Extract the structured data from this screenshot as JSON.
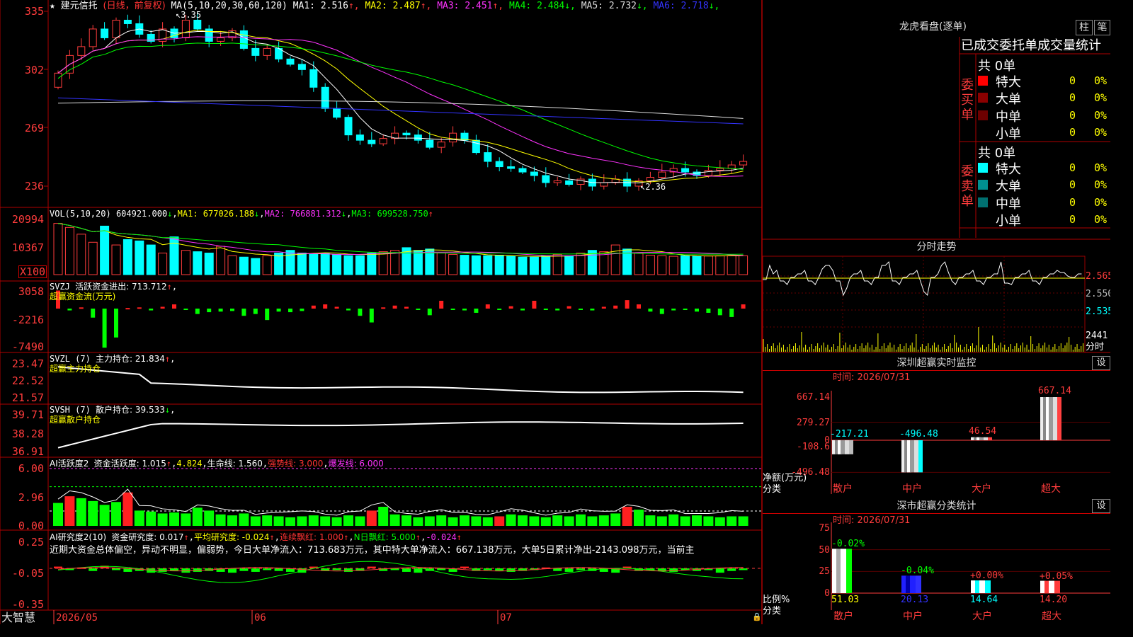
{
  "app": {
    "brand": "大智慧"
  },
  "main": {
    "star": "★",
    "stock": "建元信托",
    "mode": "(日线，前复权)",
    "ma_header": "MA(5,10,20,30,60,120)",
    "ma_items": [
      {
        "label": "MA1: 2.516",
        "arrow": "↑",
        "color": "#ffffff"
      },
      {
        "label": "MA2: 2.487",
        "arrow": "↑",
        "color": "#ffff00"
      },
      {
        "label": "MA3: 2.451",
        "arrow": "↑",
        "color": "#ff33ff"
      },
      {
        "label": "MA4: 2.484",
        "arrow": "↓",
        "color": "#00ff00"
      },
      {
        "label": "MA5: 2.732",
        "arrow": "↓",
        "color": "#dddddd"
      },
      {
        "label": "MA6: 2.718",
        "arrow": "↓",
        "color": "#3333ff"
      }
    ],
    "high_mark": "3.35",
    "low_mark": "2.36",
    "price_axis": [
      "335",
      "302",
      "269",
      "236"
    ]
  },
  "vol": {
    "header": "VOL(5,10,20)",
    "value": "604921.000",
    "ma1": "MA1: 677026.188",
    "ma2": "MA2: 766881.312",
    "ma3": "MA3: 699528.750",
    "axis": [
      "20994",
      "10367"
    ],
    "unit": "X100"
  },
  "svzj": {
    "header": "SVZJ",
    "label": "活跃资金进出: 713.712",
    "subtitle": "超赢资金流(万元)",
    "axis": [
      "3058",
      "-2216",
      "-7490"
    ]
  },
  "svzl": {
    "header": "SVZL (7)",
    "label": "主力持仓: 21.834",
    "subtitle": "超赢主力持仓",
    "axis": [
      "23.47",
      "22.52",
      "21.57"
    ]
  },
  "svsh": {
    "header": "SVSH (7)",
    "label": "散户持仓: 39.533",
    "subtitle": "超赢散户持仓",
    "axis": [
      "39.71",
      "38.28",
      "36.91"
    ]
  },
  "ai1": {
    "header": "AI活跃度2",
    "label1": "资金活跃度: 1.015",
    "v2": "4.824",
    "label3": "生命线: 1.560",
    "label4": "强势线: 3.000",
    "label5": "爆发线: 6.000",
    "axis": [
      "6.00",
      "2.96",
      "0.00"
    ]
  },
  "ai2": {
    "header": "AI研究度2(10)",
    "label1": "资金研究度: 0.017",
    "label2": "平均研究度: -0.024",
    "label3": "连续飘红: 1.000",
    "label4": "N日飘红: 5.000",
    "label5": "-0.024",
    "axis": [
      "0.25",
      "-0.05",
      "-0.35"
    ],
    "note": "近期大资金总体偏空，异动不明显，偏弱势，今日大单净流入：713.683万元，其中特大单净流入：667.138万元，大单5日累计净出-2143.098万元，当前主"
  },
  "date_axis": [
    "2026/05",
    "06",
    "07"
  ],
  "lhb": {
    "title": "龙虎看盘(逐单)",
    "btn1": "柱",
    "btn2": "笔",
    "tabs": "已成交委托单成交量统计",
    "buy_label": "委买单",
    "sell_label": "委卖单",
    "total": "共 0单",
    "rows": [
      {
        "name": "特大",
        "count": "0",
        "pct": "0%"
      },
      {
        "name": "大单",
        "count": "0",
        "pct": "0%"
      },
      {
        "name": "中单",
        "count": "0",
        "pct": "0%"
      },
      {
        "name": "小单",
        "count": "0",
        "pct": "0%"
      }
    ],
    "buy_colors": [
      "#ff0000",
      "#8b0000",
      "#6e0000",
      "#000000"
    ],
    "sell_colors": [
      "#00ffff",
      "#009090",
      "#007070",
      "#000000"
    ]
  },
  "fenshi": {
    "title": "分时走势",
    "axis": [
      "2.565",
      "2.550",
      "2.535"
    ],
    "vol_top": "2441",
    "vol_label": "分时"
  },
  "sz_monitor": {
    "title": "深圳超赢实时监控",
    "set": "设",
    "time": "时间: 2026/07/31",
    "axis": [
      "667.14",
      "279.27",
      "0",
      "-108.6",
      "-496.48"
    ],
    "ylabel": "净额(万元)",
    "xlabel": "分类",
    "chart_data": {
      "type": "bar",
      "categories": [
        "散户",
        "中户",
        "大户",
        "超大"
      ],
      "values": [
        -217.21,
        -496.48,
        46.54,
        667.14
      ],
      "labels": [
        "-217.21",
        "-496.48",
        "46.54",
        "667.14"
      ]
    }
  },
  "sz_class": {
    "title": "深市超赢分类统计",
    "set": "设",
    "time": "时间: 2026/07/31",
    "axis": [
      "75",
      "50",
      "25",
      "0"
    ],
    "ylabel": "比例%",
    "xlabel": "分类",
    "chart_data": {
      "type": "bar",
      "categories": [
        "散户",
        "中户",
        "大户",
        "超大"
      ],
      "values": [
        51.03,
        20.13,
        14.64,
        14.2
      ],
      "changes": [
        "-0.02%",
        "-0.04%",
        "+0.00%",
        "+0.05%"
      ],
      "value_labels": [
        "51.03",
        "20.13",
        "14.64",
        "14.20"
      ]
    }
  }
}
